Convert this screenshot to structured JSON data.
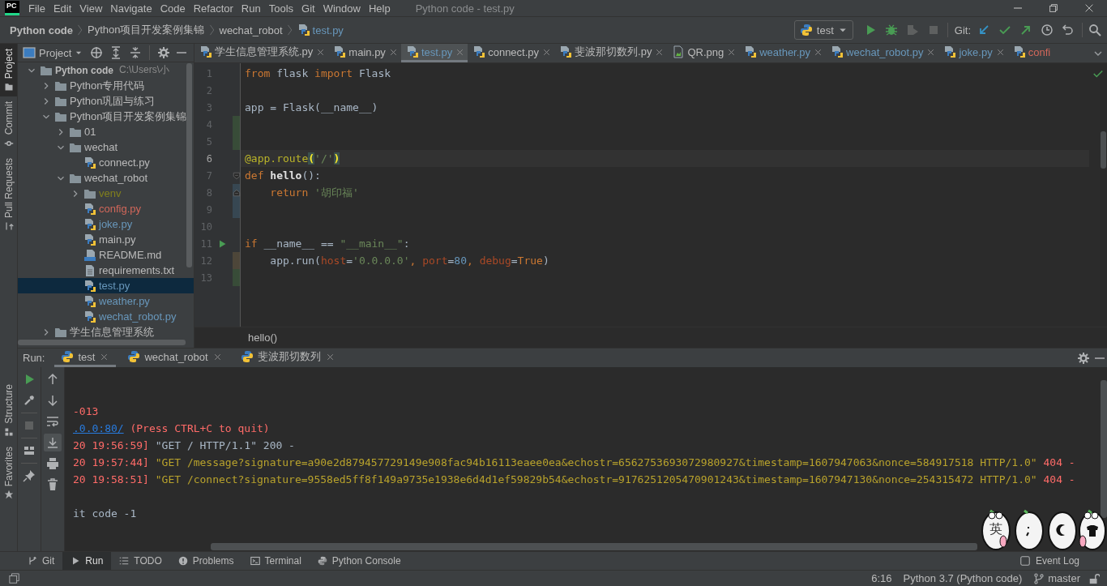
{
  "menu_bar": {
    "logo": "PC",
    "items": [
      "File",
      "Edit",
      "View",
      "Navigate",
      "Code",
      "Refactor",
      "Run",
      "Tools",
      "Git",
      "Window",
      "Help"
    ],
    "title": "Python code - test.py"
  },
  "navigation_bar": {
    "breadcrumbs": [
      {
        "label": "Python code",
        "kind": "project"
      },
      {
        "label": "Python项目开发案例集锦",
        "kind": "folder"
      },
      {
        "label": "wechat_robot",
        "kind": "folder"
      },
      {
        "label": "test.py",
        "kind": "file"
      }
    ],
    "run_config": "test",
    "actions": [
      {
        "kind": "run",
        "disabled": false
      },
      {
        "kind": "debug",
        "disabled": false
      },
      {
        "kind": "coverage",
        "disabled": true
      },
      {
        "kind": "stop",
        "disabled": true
      }
    ],
    "git_label": "Git:"
  },
  "side_stripe_top": [
    {
      "label": "Project",
      "kind": "project",
      "selected": true
    },
    {
      "label": "Commit",
      "kind": "commit",
      "selected": false
    },
    {
      "label": "Pull Requests",
      "kind": "pull",
      "selected": false
    }
  ],
  "side_stripe_bottom": [
    {
      "label": "Structure",
      "kind": "structure"
    },
    {
      "label": "Favorites",
      "kind": "favorites"
    }
  ],
  "project_panel": {
    "title": "Project",
    "tree": [
      {
        "label": "Python code",
        "kind": "root",
        "path": "C:\\Users\\小",
        "selected": false,
        "expanded": true,
        "children": [
          {
            "label": "Python专用代码",
            "kind": "folder",
            "selected": false,
            "expanded": false
          },
          {
            "label": "Python巩固与练习",
            "kind": "folder",
            "selected": false,
            "expanded": false
          },
          {
            "label": "Python项目开发案例集锦",
            "kind": "folder",
            "selected": false,
            "expanded": true,
            "children": [
              {
                "label": "01",
                "kind": "folder",
                "selected": false,
                "expanded": false
              },
              {
                "label": "wechat",
                "kind": "folder",
                "selected": false,
                "expanded": true,
                "children": [
                  {
                    "label": "connect.py",
                    "kind": "python",
                    "selected": false
                  }
                ]
              },
              {
                "label": "wechat_robot",
                "kind": "folder",
                "selected": false,
                "expanded": true,
                "children": [
                  {
                    "label": "venv",
                    "kind": "folder",
                    "color": "#82801d",
                    "selected": false,
                    "expanded": false
                  },
                  {
                    "label": "config.py",
                    "kind": "python",
                    "color": "#d1675a",
                    "selected": false
                  },
                  {
                    "label": "joke.py",
                    "kind": "python",
                    "color": "#6897bb",
                    "selected": false
                  },
                  {
                    "label": "main.py",
                    "kind": "python",
                    "selected": false
                  },
                  {
                    "label": "README.md",
                    "kind": "markdown",
                    "selected": false
                  },
                  {
                    "label": "requirements.txt",
                    "kind": "text",
                    "selected": false
                  },
                  {
                    "label": "test.py",
                    "kind": "python",
                    "color": "#6897bb",
                    "selected": true
                  },
                  {
                    "label": "weather.py",
                    "kind": "python",
                    "color": "#6897bb",
                    "selected": false
                  },
                  {
                    "label": "wechat_robot.py",
                    "kind": "python",
                    "color": "#6897bb",
                    "selected": false
                  }
                ]
              }
            ]
          },
          {
            "label": "学生信息管理系统",
            "kind": "folder",
            "selected": false,
            "expanded": false
          }
        ]
      }
    ]
  },
  "editor": {
    "tabs": [
      {
        "label": "学生信息管理系统.py",
        "kind": "python",
        "selected": false,
        "closable": true
      },
      {
        "label": "main.py",
        "kind": "python",
        "selected": false,
        "closable": true
      },
      {
        "label": "test.py",
        "kind": "python",
        "color": "#6897bb",
        "selected": true,
        "closable": true
      },
      {
        "label": "connect.py",
        "kind": "python",
        "selected": false,
        "closable": true
      },
      {
        "label": "斐波那切数列.py",
        "kind": "python",
        "selected": false,
        "closable": true
      },
      {
        "label": "QR.png",
        "kind": "image",
        "selected": false,
        "closable": true
      },
      {
        "label": "weather.py",
        "kind": "python",
        "color": "#6897bb",
        "selected": false,
        "closable": true
      },
      {
        "label": "wechat_robot.py",
        "kind": "python",
        "color": "#6897bb",
        "selected": false,
        "closable": true
      },
      {
        "label": "joke.py",
        "kind": "python",
        "color": "#6897bb",
        "selected": false,
        "closable": true
      },
      {
        "label": "confi",
        "kind": "python",
        "color": "#d1675a",
        "selected": false,
        "closable": false
      }
    ],
    "lines": [
      {
        "number": "1",
        "kind": "plain",
        "current": false,
        "tokens": [
          {
            "text": "from",
            "kind": "keyword"
          },
          {
            "text": " flask ",
            "kind": "plain"
          },
          {
            "text": "import",
            "kind": "keyword"
          },
          {
            "text": " Flask",
            "kind": "plain"
          }
        ]
      },
      {
        "number": "2",
        "kind": "plain",
        "current": false
      },
      {
        "number": "3",
        "kind": "plain",
        "current": false,
        "tokens": [
          {
            "text": "app = Flask(__name__)",
            "kind": "plain"
          }
        ]
      },
      {
        "number": "4",
        "kind": "plain",
        "color": "#384c38",
        "current": false
      },
      {
        "number": "5",
        "kind": "plain",
        "color": "#384c38",
        "current": false
      },
      {
        "number": "6",
        "kind": "plain",
        "current": true,
        "tokens": [
          {
            "text": "@app.route",
            "kind": "decorator"
          },
          {
            "text": "(",
            "kind": "brace"
          },
          {
            "text": "'/'",
            "kind": "string"
          },
          {
            "text": ")",
            "kind": "brace"
          }
        ]
      },
      {
        "number": "7",
        "kind": "foldstart",
        "current": false,
        "tokens": [
          {
            "text": "def",
            "kind": "keyword"
          },
          {
            "text": " hello",
            "kind": "name"
          },
          {
            "text": "():",
            "kind": "plain"
          }
        ]
      },
      {
        "number": "8",
        "kind": "foldend",
        "color": "#374752",
        "current": false,
        "tokens": [
          {
            "text": "    return",
            "kind": "keyword"
          },
          {
            "text": " '胡印福'",
            "kind": "string"
          }
        ]
      },
      {
        "number": "9",
        "kind": "plain",
        "color": "#374752",
        "current": false
      },
      {
        "number": "10",
        "kind": "plain",
        "current": false
      },
      {
        "number": "11",
        "kind": "runnable",
        "current": false,
        "tokens": [
          {
            "text": "if",
            "kind": "keyword"
          },
          {
            "text": " __name__ == ",
            "kind": "plain"
          },
          {
            "text": "\"__main__\"",
            "kind": "string"
          },
          {
            "text": ":",
            "kind": "plain"
          }
        ]
      },
      {
        "number": "12",
        "kind": "plain",
        "color": "#4d4639",
        "current": false,
        "tokens": [
          {
            "text": "    app.run(",
            "kind": "plain"
          },
          {
            "text": "host",
            "kind": "param"
          },
          {
            "text": "=",
            "kind": "plain"
          },
          {
            "text": "'0.0.0.0'",
            "kind": "string"
          },
          {
            "text": ", ",
            "kind": "keyword"
          },
          {
            "text": "port",
            "kind": "param"
          },
          {
            "text": "=",
            "kind": "plain"
          },
          {
            "text": "80",
            "kind": "number"
          },
          {
            "text": ", ",
            "kind": "keyword"
          },
          {
            "text": "debug",
            "kind": "param"
          },
          {
            "text": "=",
            "kind": "plain"
          },
          {
            "text": "True",
            "kind": "keyword"
          },
          {
            "text": ")",
            "kind": "plain"
          }
        ]
      },
      {
        "number": "13",
        "kind": "plain",
        "color": "#384c38",
        "current": false
      }
    ],
    "breadcrumb": "hello()"
  },
  "run_panel": {
    "label": "Run:",
    "tabs": [
      {
        "label": "test",
        "selected": true
      },
      {
        "label": "wechat_robot",
        "selected": false
      },
      {
        "label": "斐波那切数列",
        "selected": false
      }
    ],
    "console": [
      {
        "kind": "log",
        "tokens": [
          {
            "text": "-013",
            "kind": "error"
          }
        ]
      },
      {
        "kind": "log",
        "tokens": [
          {
            "text": ".0.0:80/",
            "kind": "link"
          },
          {
            "text": " (Press CTRL+C to quit)",
            "kind": "error"
          }
        ]
      },
      {
        "kind": "log",
        "tokens": [
          {
            "text": "20 19:56:59] ",
            "kind": "error"
          },
          {
            "text": "\"GET / HTTP/1.1\" 200 -",
            "kind": "plain"
          }
        ]
      },
      {
        "kind": "log",
        "tokens": [
          {
            "text": "20 19:57:44] ",
            "kind": "error"
          },
          {
            "text": "\"GET /message?signature=a90e2d879457729149e908fac94b16113eaee0ea&echostr=6562753693072980927&timestamp=1607947063&nonce=584917518 HTTP/1.0\" ",
            "kind": "warning"
          },
          {
            "text": "404 -",
            "kind": "error"
          }
        ]
      },
      {
        "kind": "log",
        "tokens": [
          {
            "text": "20 19:58:51] ",
            "kind": "error"
          },
          {
            "text": "\"GET /connect?signature=9558ed5ff8f149a9735e1938e6d4d1ef59829b54&echostr=9176251205470901243&timestamp=1607947130&nonce=254315472 HTTP/1.0\" ",
            "kind": "warning"
          },
          {
            "text": "404 -",
            "kind": "error"
          }
        ]
      },
      {
        "kind": "exit",
        "tokens": [
          {
            "text": "it code -1",
            "kind": "plain"
          }
        ]
      }
    ]
  },
  "tool_window_bar": {
    "items": [
      {
        "label": "Git",
        "kind": "git",
        "selected": false
      },
      {
        "label": "Run",
        "kind": "run",
        "selected": true
      },
      {
        "label": "TODO",
        "kind": "todo",
        "selected": false
      },
      {
        "label": "Problems",
        "kind": "problems",
        "selected": false
      },
      {
        "label": "Terminal",
        "kind": "terminal",
        "selected": false
      },
      {
        "label": "Python Console",
        "kind": "console",
        "selected": false
      }
    ],
    "event_log": "Event Log"
  },
  "status_bar": {
    "position": "6:16",
    "interpreter": "Python 3.7 (Python code)",
    "branch": "master"
  },
  "ime_toolbar": {
    "label": "英"
  }
}
